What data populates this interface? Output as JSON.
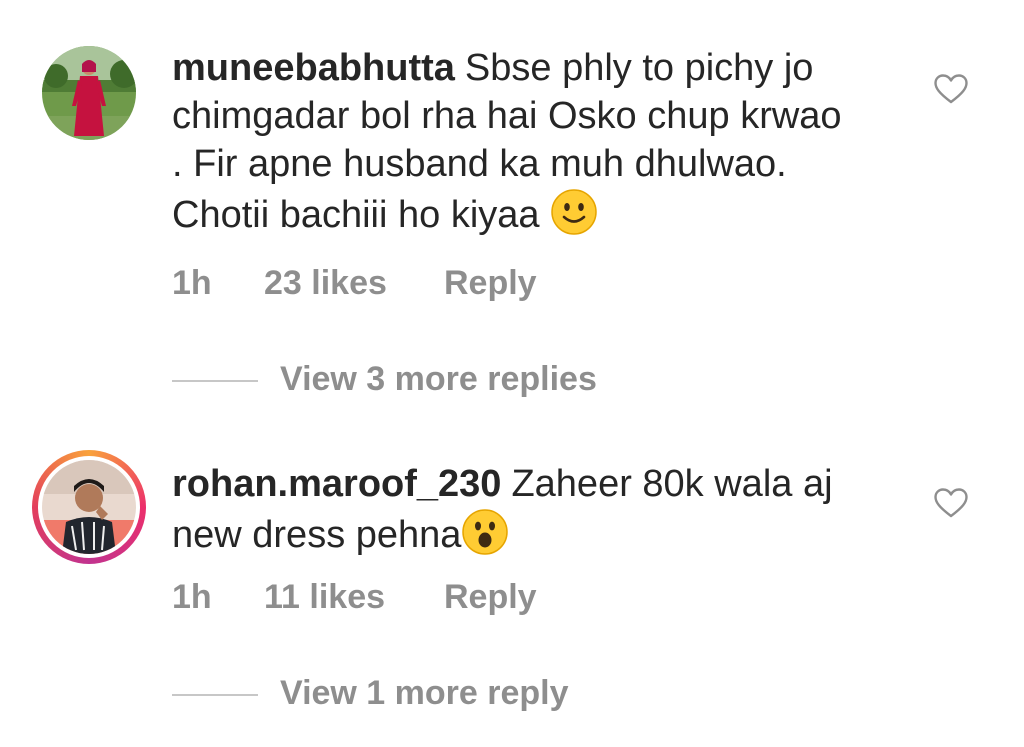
{
  "comments": [
    {
      "username": "muneebabhutta",
      "text": "Sbse phly to pichy jo chimgadar bol rha hai Osko chup krwao . Fir apne husband ka muh dhulwao. Chotii bachiii ho kiyaa",
      "emoji": "slightly-smiling-face",
      "time": "1h",
      "likes": "23 likes",
      "reply_label": "Reply",
      "view_replies": "View 3 more replies"
    },
    {
      "username": "rohan.maroof_230",
      "text": "Zaheer 80k wala aj new dress pehna",
      "emoji": "face-with-open-mouth",
      "time": "1h",
      "likes": "11 likes",
      "reply_label": "Reply",
      "view_replies": "View 1 more reply"
    }
  ],
  "icons": {
    "like": "heart-outline-icon"
  },
  "colors": {
    "text": "#262626",
    "muted": "#8e8e8e",
    "divider": "#c7c7c7",
    "story_ring": "#ec2f6b",
    "emoji_fill": "#ffcc33"
  }
}
